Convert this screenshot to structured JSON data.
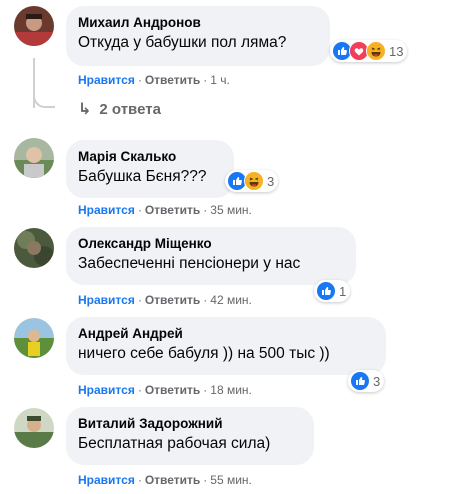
{
  "comments": [
    {
      "author": "Михаил Андронов",
      "text": "Откуда у бабушки пол ляма?",
      "like_label": "Нравится",
      "reply_label": "Ответить",
      "time": "1 ч.",
      "reaction_count": "13",
      "reactions": [
        "like-icon",
        "love-icon",
        "haha-icon"
      ],
      "replies_label": "2 ответа"
    },
    {
      "author": "Марія Скалько",
      "text": "Бабушка Бєня???",
      "like_label": "Нравится",
      "reply_label": "Ответить",
      "time": "35 мин.",
      "reaction_count": "3",
      "reactions": [
        "like-icon",
        "haha-icon"
      ]
    },
    {
      "author": "Олександр Міщенко",
      "text": "Забеспеченні пенсіонери у нас",
      "like_label": "Нравится",
      "reply_label": "Ответить",
      "time": "42 мин.",
      "reaction_count": "1",
      "reactions": [
        "like-icon"
      ]
    },
    {
      "author": "Андрей Андрей",
      "text": "ничего себе бабуля )) на 500 тыс ))",
      "like_label": "Нравится",
      "reply_label": "Ответить",
      "time": "18 мин.",
      "reaction_count": "3",
      "reactions": [
        "like-icon"
      ]
    },
    {
      "author": "Виталий Задорожний",
      "text": "Бесплатная рабочая сила)",
      "like_label": "Нравится",
      "reply_label": "Ответить",
      "time": "55 мин."
    }
  ],
  "colors": {
    "like_blue": "#1877f2",
    "love_red": "#f33e58",
    "haha_yellow": "#f7b125",
    "bubble_bg": "#f0f2f5",
    "meta_gray": "#65676b"
  }
}
